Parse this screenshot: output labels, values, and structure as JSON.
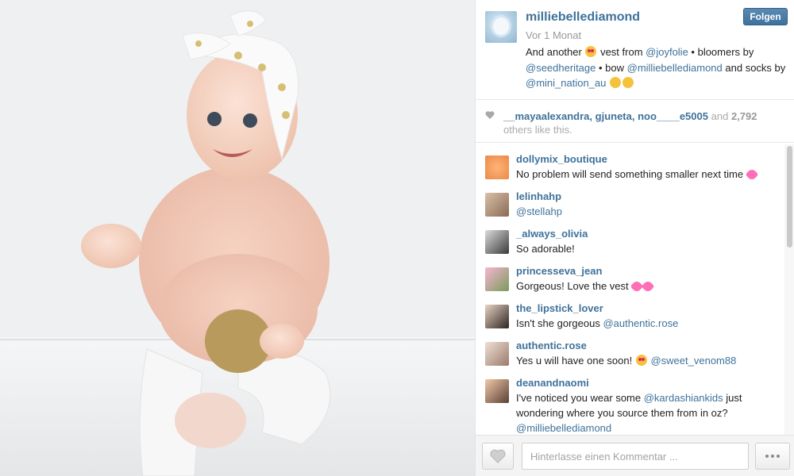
{
  "post": {
    "owner": "milliebellediamond",
    "age": "Vor 1 Monat",
    "follow_label": "Folgen",
    "caption": {
      "t1": "And another ",
      "t2": " vest from ",
      "m1": "@joyfolie",
      "t3": " • bloomers by ",
      "m2": "@seedheritage",
      "t4": " • bow ",
      "m3": "@milliebellediamond",
      "t5": " and socks by ",
      "m4": "@mini_nation_au"
    }
  },
  "likes": {
    "names": "__mayaalexandra, gjuneta, noo____e5005",
    "and_label": "and",
    "count": "2,792",
    "suffix": "others like this."
  },
  "comments": [
    {
      "user": "dollymix_boutique",
      "text": "No problem will send something smaller next time",
      "avatar_color": "#f5a36b"
    },
    {
      "user": "lelinhahp",
      "text": "",
      "mention": "@stellahp",
      "avatar_color": "#c9a98a"
    },
    {
      "user": "_always_olivia",
      "text": "So adorable!",
      "avatar_color": "#6e6e6e"
    },
    {
      "user": "princesseva_jean",
      "text": "Gorgeous! Love the vest",
      "avatar_color": "#d98bb0"
    },
    {
      "user": "the_lipstick_lover",
      "text": "Isn't she gorgeous ",
      "mention": "@authentic.rose",
      "avatar_color": "#4a3a35"
    },
    {
      "user": "authentic.rose",
      "text": "Yes u will have one soon! ",
      "mention": "@sweet_venom88",
      "avatar_color": "#a88a7a"
    },
    {
      "user": "deanandnaomi",
      "text": "I've noticed you wear some ",
      "mention": "@kardashiankids",
      "text2": " just wondering where you source them from in oz?",
      "mention2": "@milliebellediamond",
      "avatar_color": "#8b6b5a"
    }
  ],
  "footer": {
    "comment_placeholder": "Hinterlasse einen Kommentar ..."
  },
  "icons": {
    "like": "heart-icon",
    "more": "more-options-icon",
    "emoji": "smiley-emoji-icon"
  }
}
